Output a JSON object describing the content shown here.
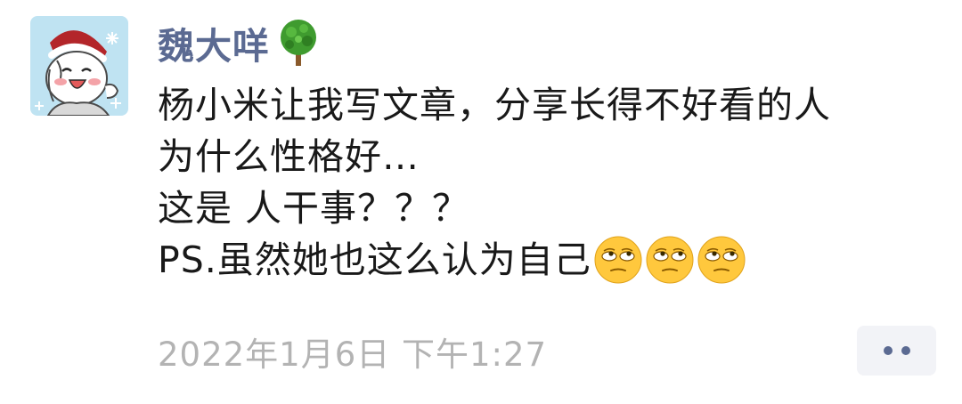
{
  "post": {
    "author": "魏大咩",
    "author_badge_icon": "tree-icon",
    "avatar_icon": "avatar-cartoon",
    "lines": [
      "杨小米让我写文章，分享长得不好看的人",
      "为什么性格好…",
      "这是 人干事？？？",
      "PS.虽然她也这么认为自己"
    ],
    "trailing_emojis": [
      "eye-roll-emoji",
      "eye-roll-emoji",
      "eye-roll-emoji"
    ],
    "timestamp": "2022年1月6日 下午1:27"
  },
  "colors": {
    "author": "#5b6a92",
    "text": "#191919",
    "timestamp": "#b3b3b3",
    "more_button_bg": "#f2f3f7",
    "more_dots": "#5b6a92"
  }
}
